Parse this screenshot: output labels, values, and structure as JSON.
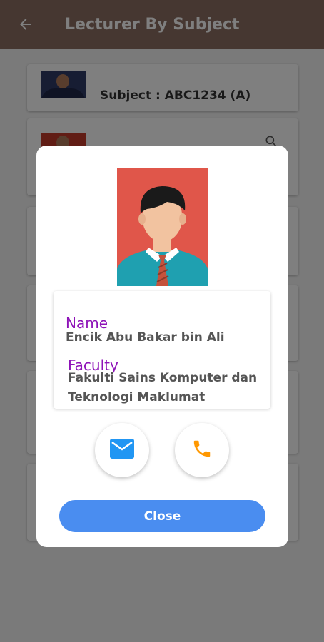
{
  "app_bar": {
    "title": "Lecturer By Subject",
    "back_icon": "arrow-back-icon",
    "background_color": "#8d6e63"
  },
  "list": {
    "cards": [
      {
        "subject_text": "Subject : ABC1234 (A)"
      },
      {
        "icon": "search-icon"
      }
    ]
  },
  "dialog": {
    "name_label": "Name",
    "name_value": "Encik Abu Bakar bin Ali",
    "faculty_label": "Faculty",
    "faculty_value": "Fakulti Sains Komputer dan Teknologi Maklumat",
    "email_icon": "email-icon",
    "phone_icon": "phone-icon",
    "close_label": "Close",
    "label_color": "#8e13b8",
    "email_icon_color": "#2196f3",
    "phone_icon_color": "#ff9800",
    "close_button_color": "#4a8df0"
  }
}
